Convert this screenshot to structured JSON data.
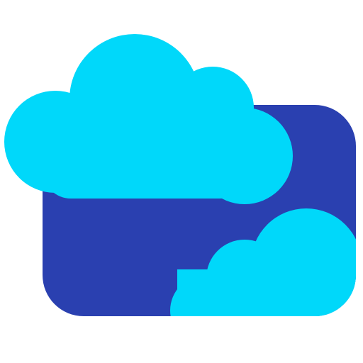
{
  "icon": {
    "name": "cloud-card-icon",
    "colors": {
      "card": "#2A40B0",
      "cloud": "#00D8FA",
      "background": "#FFFFFF"
    }
  }
}
